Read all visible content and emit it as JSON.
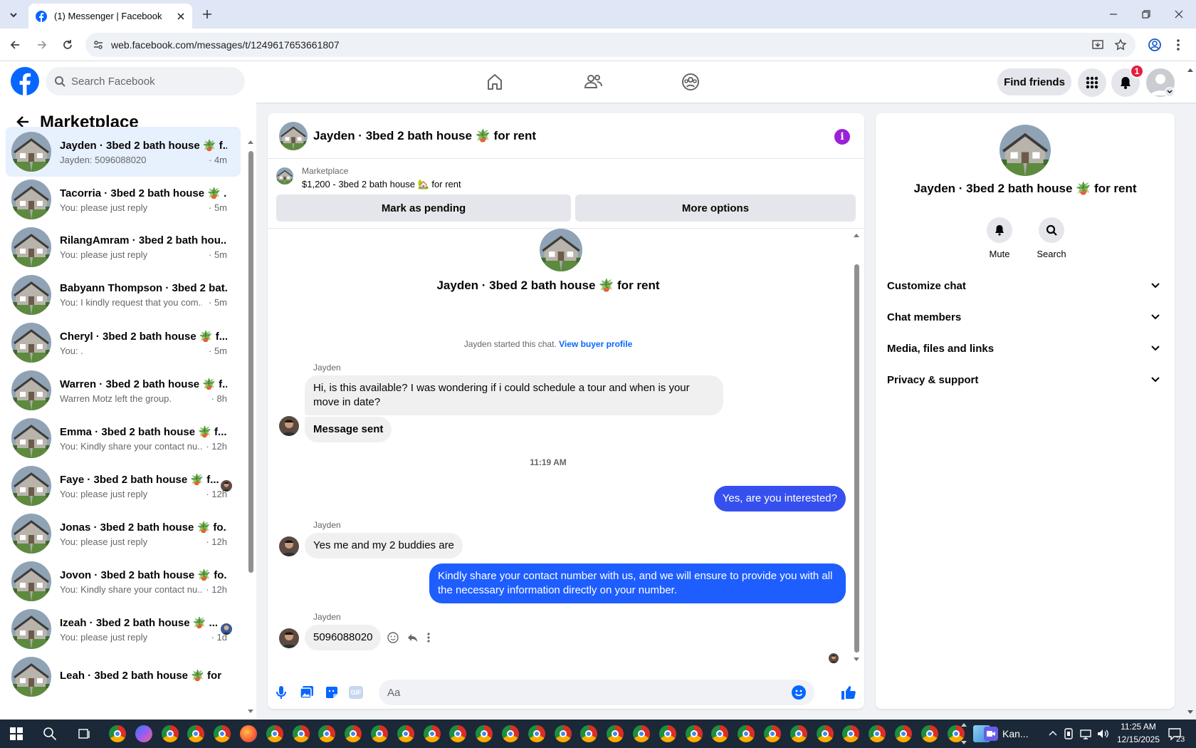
{
  "browser": {
    "tab_title": "(1) Messenger | Facebook",
    "url": "web.facebook.com/messages/t/1249617653661807"
  },
  "header": {
    "search_placeholder": "Search Facebook",
    "find_friends": "Find friends",
    "notification_count": "1"
  },
  "sidebar": {
    "title": "Marketplace",
    "conversations": [
      {
        "name": "Jayden · 3bed 2 bath house 🪴 f...",
        "msg": "Jayden: 5096088020",
        "time": "· 4m",
        "active": true
      },
      {
        "name": "Tacorria · 3bed 2 bath house 🪴 ...",
        "msg": "You: please just reply",
        "time": "· 5m"
      },
      {
        "name": "RilangAmram · 3bed 2 bath hou...",
        "msg": "You: please just reply",
        "time": "· 5m"
      },
      {
        "name": "Babyann Thompson · 3bed 2 bat...",
        "msg": "You: I kindly request that you com...",
        "time": "· 5m"
      },
      {
        "name": "Cheryl · 3bed 2 bath house 🪴 f...",
        "msg": "You: .",
        "time": "· 5m"
      },
      {
        "name": "Warren · 3bed 2 bath house 🪴 f...",
        "msg": "Warren Motz left the group.",
        "time": "· 8h"
      },
      {
        "name": "Emma · 3bed 2 bath house 🪴 f...",
        "msg": "You: Kindly share your contact nu...",
        "time": "· 12h"
      },
      {
        "name": "Faye · 3bed 2 bath house 🪴 f...",
        "msg": "You: please just reply",
        "time": "· 12h"
      },
      {
        "name": "Jonas · 3bed 2 bath house 🪴 fo...",
        "msg": "You: please just reply",
        "time": "· 12h"
      },
      {
        "name": "Jovon · 3bed 2 bath house 🪴 fo...",
        "msg": "You: Kindly share your contact nu...",
        "time": "· 12h"
      },
      {
        "name": "Izeah · 3bed 2 bath house 🪴 ...",
        "msg": "You: please just reply",
        "time": "· 1d"
      },
      {
        "name": "Leah · 3bed 2 bath house 🪴 for",
        "msg": "",
        "time": ""
      }
    ]
  },
  "chat": {
    "title": "Jayden · 3bed 2 bath house 🪴 for rent",
    "marketplace_label": "Marketplace",
    "listing": "$1,200 - 3bed 2 bath house 🏡 for rent",
    "mark_pending": "Mark as pending",
    "more_options": "More options",
    "intro_name": "Jayden · 3bed 2 bath house 🪴 for rent",
    "started_text": "Jayden started this chat.",
    "buyer_profile_link": "View buyer profile",
    "sender_name": "Jayden",
    "msg1": "Hi, is this available? I was wondering if i could schedule a tour and when is your move in date?",
    "msg2": "Message sent",
    "timestamp": "11:19 AM",
    "msg3": "Yes, are you interested?",
    "msg4": "Yes me and my 2 buddies are",
    "msg5": "Kindly share your contact number with us, and we will ensure to provide you with all the necessary information directly on your number.",
    "msg6": "5096088020",
    "composer_placeholder": "Aa"
  },
  "details": {
    "name": "Jayden · 3bed 2 bath house 🪴 for rent",
    "mute": "Mute",
    "search": "Search",
    "sections": [
      "Customize chat",
      "Chat members",
      "Media, files and links",
      "Privacy & support"
    ]
  },
  "taskbar": {
    "app_label": "Kan...",
    "time": "11:25 AM",
    "date": "12/15/2025",
    "notif_count": "23"
  },
  "colors": {
    "fb_blue": "#0866ff",
    "out_bubble": "#1e5eff",
    "info_purple": "#9b20d9"
  }
}
